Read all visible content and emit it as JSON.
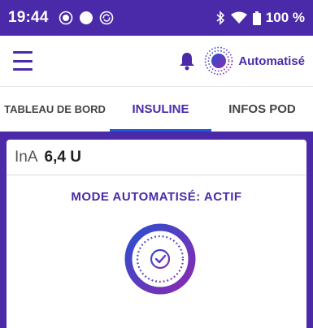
{
  "status_bar": {
    "time": "19:44",
    "battery": "100 %",
    "icons": [
      "brightness-icon",
      "circle-icon",
      "sync-icon",
      "bluetooth-icon",
      "wifi-icon",
      "battery-icon"
    ]
  },
  "app_bar": {
    "mode_label": "Automatisé",
    "icons": [
      "menu-icon",
      "bell-icon",
      "auto-mode-icon"
    ]
  },
  "tabs": [
    {
      "label": "TABLEAU DE BORD",
      "active": false
    },
    {
      "label": "INSULINE",
      "active": true
    },
    {
      "label": "INFOS POD",
      "active": false
    }
  ],
  "card": {
    "ina_label": "InA",
    "ina_value": "6,4 U",
    "mode_status": "MODE AUTOMATISÉ: ACTIF"
  },
  "colors": {
    "primary": "#4a2aa8",
    "tab_underline": "#1e5fd9",
    "gradient_start": "#2a4fd0",
    "gradient_end": "#8a2ab0"
  }
}
